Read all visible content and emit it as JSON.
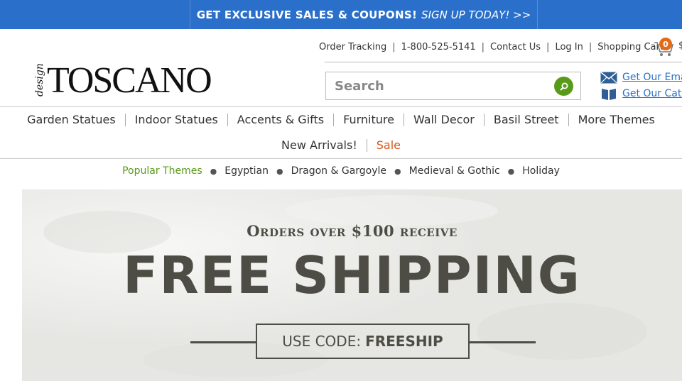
{
  "promo": {
    "headline": "GET EXCLUSIVE SALES & COUPONS!",
    "cta": "SIGN UP TODAY! >>"
  },
  "utility": {
    "order_tracking": "Order Tracking",
    "phone": "1-800-525-5141",
    "contact": "Contact Us",
    "login": "Log In",
    "cart": "Shopping Cart",
    "cart_count": "0",
    "cart_amount": "$"
  },
  "logo": {
    "prefix": "design",
    "brand": "TOSCANO"
  },
  "search": {
    "placeholder": "Search"
  },
  "side_links": {
    "email": "Get Our Emails",
    "catalog": "Get Our Catalog"
  },
  "nav": {
    "row1": [
      "Garden Statues",
      "Indoor Statues",
      "Accents & Gifts",
      "Furniture",
      "Wall Decor",
      "Basil Street",
      "More Themes"
    ],
    "row2": [
      "New Arrivals!",
      "Sale"
    ]
  },
  "themes": {
    "lead": "Popular Themes",
    "items": [
      "Egyptian",
      "Dragon & Gargoyle",
      "Medieval & Gothic",
      "Holiday"
    ]
  },
  "banner": {
    "line1": "Orders over $100 receive",
    "line2": "FREE SHIPPING",
    "code_label": "USE CODE:",
    "code_value": "FREESHIP"
  },
  "colors": {
    "promo_bg": "#2a6fc9",
    "accent_green": "#5a9a1a",
    "sale_orange": "#d6541a",
    "link_blue": "#2a6fc9",
    "banner_text": "#4d4d45"
  }
}
